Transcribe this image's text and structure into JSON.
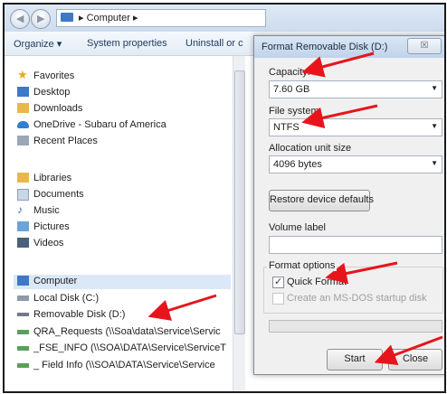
{
  "address_bar": {
    "back": "◀",
    "forward": "▶",
    "sep1": "▸",
    "location": "Computer",
    "sep2": "▸"
  },
  "toolbar": {
    "organize": "Organize ▾",
    "system_properties": "System properties",
    "uninstall": "Uninstall or c"
  },
  "nav": {
    "favorites": {
      "header": "Favorites",
      "items": [
        "Desktop",
        "Downloads",
        "OneDrive - Subaru of America",
        "Recent Places"
      ]
    },
    "libraries": {
      "header": "Libraries",
      "items": [
        "Documents",
        "Music",
        "Pictures",
        "Videos"
      ]
    },
    "computer": {
      "header": "Computer",
      "items": [
        "Local Disk (C:)",
        "Removable Disk (D:)",
        "QRA_Requests (\\\\Soa\\data\\Service\\Servic",
        "_FSE_INFO (\\\\SOA\\DATA\\Service\\ServiceT",
        "_ Field Info (\\\\SOA\\DATA\\Service\\Service"
      ]
    }
  },
  "dialog": {
    "title": "Format Removable Disk (D:)",
    "close": "☒",
    "capacity_label": "Capacity:",
    "capacity_value": "7.60 GB",
    "filesystem_label": "File system",
    "filesystem_value": "NTFS",
    "alloc_label": "Allocation unit size",
    "alloc_value": "4096 bytes",
    "restore_button": "Restore device defaults",
    "volume_label": "Volume label",
    "volume_value": "",
    "format_options": "Format options",
    "quick_format": "Quick Format",
    "quick_format_checked": true,
    "msdos": "Create an MS-DOS startup disk",
    "msdos_checked": false,
    "progress": 0,
    "start_button": "Start",
    "close_button": "Close"
  },
  "colors": {
    "annotation_arrow": "#e8141c",
    "folder": "#e8b84a",
    "computer": "#3f78c8"
  }
}
